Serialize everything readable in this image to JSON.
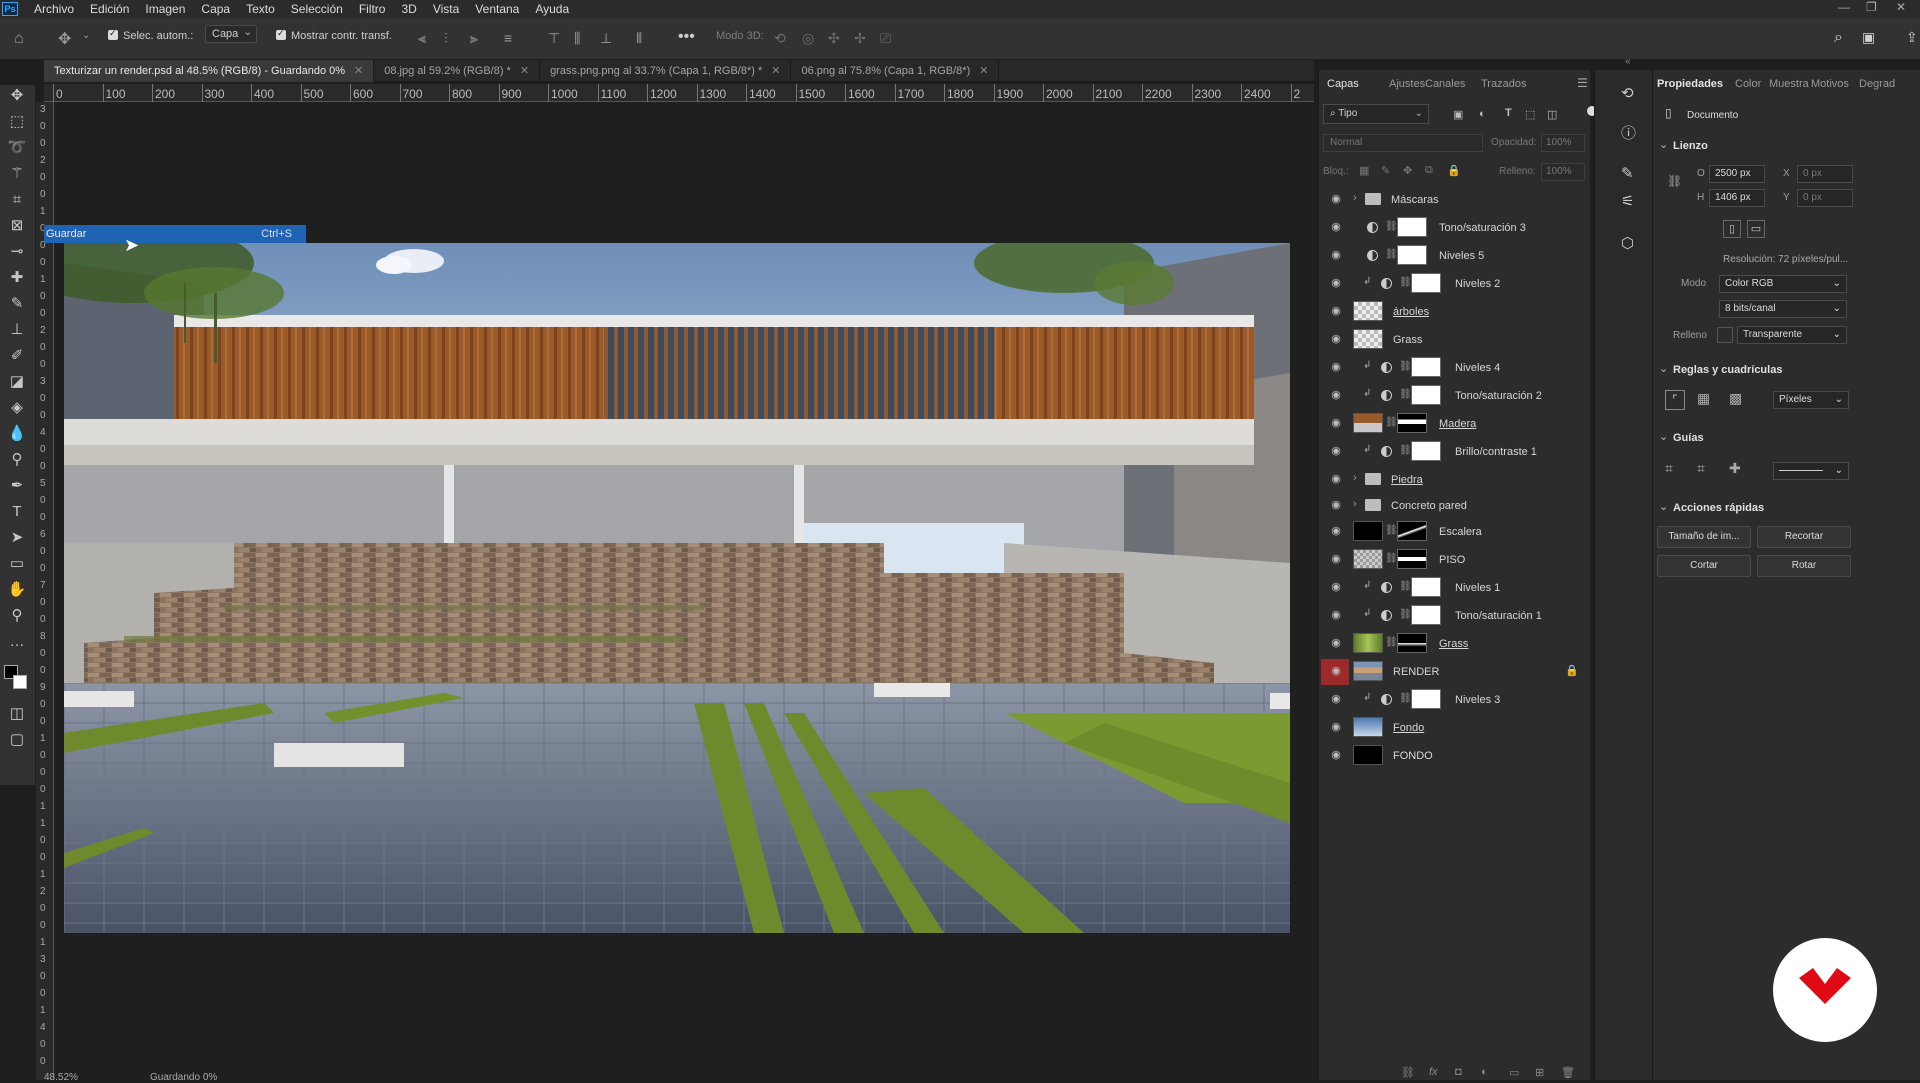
{
  "menu": {
    "app_icon": "Ps",
    "items": [
      "Archivo",
      "Edición",
      "Imagen",
      "Capa",
      "Texto",
      "Selección",
      "Filtro",
      "3D",
      "Vista",
      "Ventana",
      "Ayuda"
    ]
  },
  "options_bar": {
    "auto_select_label": "Selec. autom.:",
    "auto_select_target": "Capa",
    "show_transform_label": "Mostrar contr. transf.",
    "mode_3d_label": "Modo 3D:"
  },
  "tabs": [
    {
      "label": "Texturizar un render.psd al 48.5% (RGB/8) - Guardando 0%",
      "active": true
    },
    {
      "label": "08.jpg al 59.2% (RGB/8) *",
      "active": false
    },
    {
      "label": "grass.png.png al 33.7% (Capa 1, RGB/8*) *",
      "active": false
    },
    {
      "label": "06.png al 75.8% (Capa 1, RGB/8*)",
      "active": false
    }
  ],
  "ruler_top": [
    "0",
    "100",
    "200",
    "300",
    "400",
    "500",
    "600",
    "700",
    "800",
    "900",
    "1000",
    "1100",
    "1200",
    "1300",
    "1400",
    "1500",
    "1600",
    "1700",
    "1800",
    "1900",
    "2000",
    "2100",
    "2200",
    "2300",
    "2400",
    "2"
  ],
  "ruler_left": [
    "3",
    "0",
    "0",
    "2",
    "0",
    "0",
    "1",
    "0",
    "0",
    "0",
    "1",
    "0",
    "0",
    "2",
    "0",
    "0",
    "3",
    "0",
    "0",
    "4",
    "0",
    "0",
    "5",
    "0",
    "0",
    "6",
    "0",
    "0",
    "7",
    "0",
    "0",
    "8",
    "0",
    "0",
    "9",
    "0",
    "0",
    "1",
    "0",
    "0",
    "0",
    "1",
    "1",
    "0",
    "0",
    "1",
    "2",
    "0",
    "0",
    "1",
    "3",
    "0",
    "0",
    "1",
    "4",
    "0",
    "0"
  ],
  "tooltip": {
    "label": "Guardar",
    "shortcut": "Ctrl+S"
  },
  "layers_panel": {
    "tabs": [
      "Capas",
      "Ajustes",
      "Canales",
      "Trazados"
    ],
    "filter_kind": "Tipo",
    "blend_mode": "Normal",
    "opacity_label": "Opacidad:",
    "opacity_value": "100%",
    "lock_label": "Bloq.:",
    "fill_label": "Relleno:",
    "fill_value": "100%",
    "layers": [
      {
        "name": "Máscaras",
        "kind": "group"
      },
      {
        "name": "Tono/saturación 3",
        "kind": "adjustment"
      },
      {
        "name": "Niveles 5",
        "kind": "adjustment"
      },
      {
        "name": "Niveles 2",
        "kind": "adjustment-clipped"
      },
      {
        "name": "árboles",
        "kind": "pixel-checker",
        "underline": true
      },
      {
        "name": "Grass",
        "kind": "pixel-checker"
      },
      {
        "name": "Niveles 4",
        "kind": "adjustment-clipped"
      },
      {
        "name": "Tono/saturación 2",
        "kind": "adjustment-clipped"
      },
      {
        "name": "Madera",
        "kind": "pixel-masked",
        "underline": true
      },
      {
        "name": "Brillo/contraste 1",
        "kind": "adjustment-clipped"
      },
      {
        "name": "Piedra",
        "kind": "group",
        "underline": true
      },
      {
        "name": "Concreto pared",
        "kind": "group"
      },
      {
        "name": "Escalera",
        "kind": "pixel-masked-black"
      },
      {
        "name": "PISO",
        "kind": "pixel-masked"
      },
      {
        "name": "Niveles 1",
        "kind": "adjustment-clipped"
      },
      {
        "name": "Tono/saturación 1",
        "kind": "adjustment-clipped"
      },
      {
        "name": "Grass",
        "kind": "pixel-masked-grass",
        "underline": true
      },
      {
        "name": "RENDER",
        "kind": "render",
        "locked": true,
        "highlighted_eye": true
      },
      {
        "name": "Niveles 3",
        "kind": "adjustment-clipped"
      },
      {
        "name": "Fondo",
        "kind": "pixel-sky",
        "underline": true
      },
      {
        "name": "FONDO",
        "kind": "pixel-black"
      }
    ]
  },
  "properties_panel": {
    "tabs": [
      "Propiedades",
      "Color",
      "Muestra",
      "Motivos",
      "Degrad"
    ],
    "document_label": "Documento",
    "canvas_title": "Lienzo",
    "width_label": "O",
    "width_value": "2500 px",
    "height_label": "H",
    "height_value": "1406 px",
    "x_label": "X",
    "x_value": "0 px",
    "y_label": "Y",
    "y_value": "0 px",
    "resolution": "Resolución: 72 píxeles/pul...",
    "mode_label": "Modo",
    "mode_value": "Color RGB",
    "depth_value": "8 bits/canal",
    "fill_label": "Relleno",
    "fill_value": "Transparente",
    "rulers_title": "Reglas y cuadrículas",
    "units_value": "Píxeles",
    "guides_title": "Guías",
    "quick_actions_title": "Acciones rápidas",
    "quick_actions": [
      "Tamaño de im...",
      "Recortar",
      "Cortar",
      "Rotar"
    ]
  },
  "status_bar": {
    "zoom": "48.52%",
    "status": "Guardando 0%"
  },
  "colors": {
    "accent": "#1f63b5",
    "render_eye_highlight": "#9c2a2a",
    "badge_red": "#e00a14"
  }
}
